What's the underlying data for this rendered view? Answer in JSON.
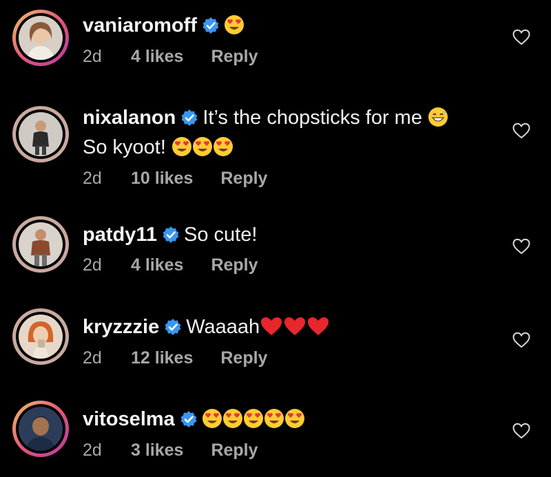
{
  "comments": [
    {
      "username": "vaniaromoff",
      "text": "",
      "text2": "",
      "time": "2d",
      "likes": "4 likes",
      "reply": "Reply",
      "emoji": [
        "heart-eyes"
      ]
    },
    {
      "username": "nixalanon",
      "text": "It’s the chopsticks for me",
      "text2": "So kyoot!",
      "time": "2d",
      "likes": "10 likes",
      "reply": "Reply",
      "emoji": [
        "grinning-sweat"
      ],
      "emoji2": [
        "heart-eyes",
        "heart-eyes",
        "heart-eyes"
      ]
    },
    {
      "username": "patdy11",
      "text": "So cute!",
      "time": "2d",
      "likes": "4 likes",
      "reply": "Reply"
    },
    {
      "username": "kryzzzie",
      "text": "Waaaah",
      "time": "2d",
      "likes": "12 likes",
      "reply": "Reply",
      "emoji": [
        "red-heart",
        "red-heart",
        "red-heart"
      ]
    },
    {
      "username": "vitoselma",
      "text": "",
      "time": "2d",
      "likes": "3 likes",
      "reply": "Reply",
      "emoji": [
        "heart-eyes",
        "heart-eyes",
        "heart-eyes",
        "heart-eyes",
        "heart-eyes"
      ]
    }
  ],
  "colors": {
    "background": "#000000",
    "text": "#f2f2f2",
    "meta": "#a8a8a8",
    "verified": "#3897f0",
    "story_ring": "#e0577a"
  },
  "icons": {
    "verified": "verified-badge-icon",
    "like": "heart-outline-icon"
  }
}
